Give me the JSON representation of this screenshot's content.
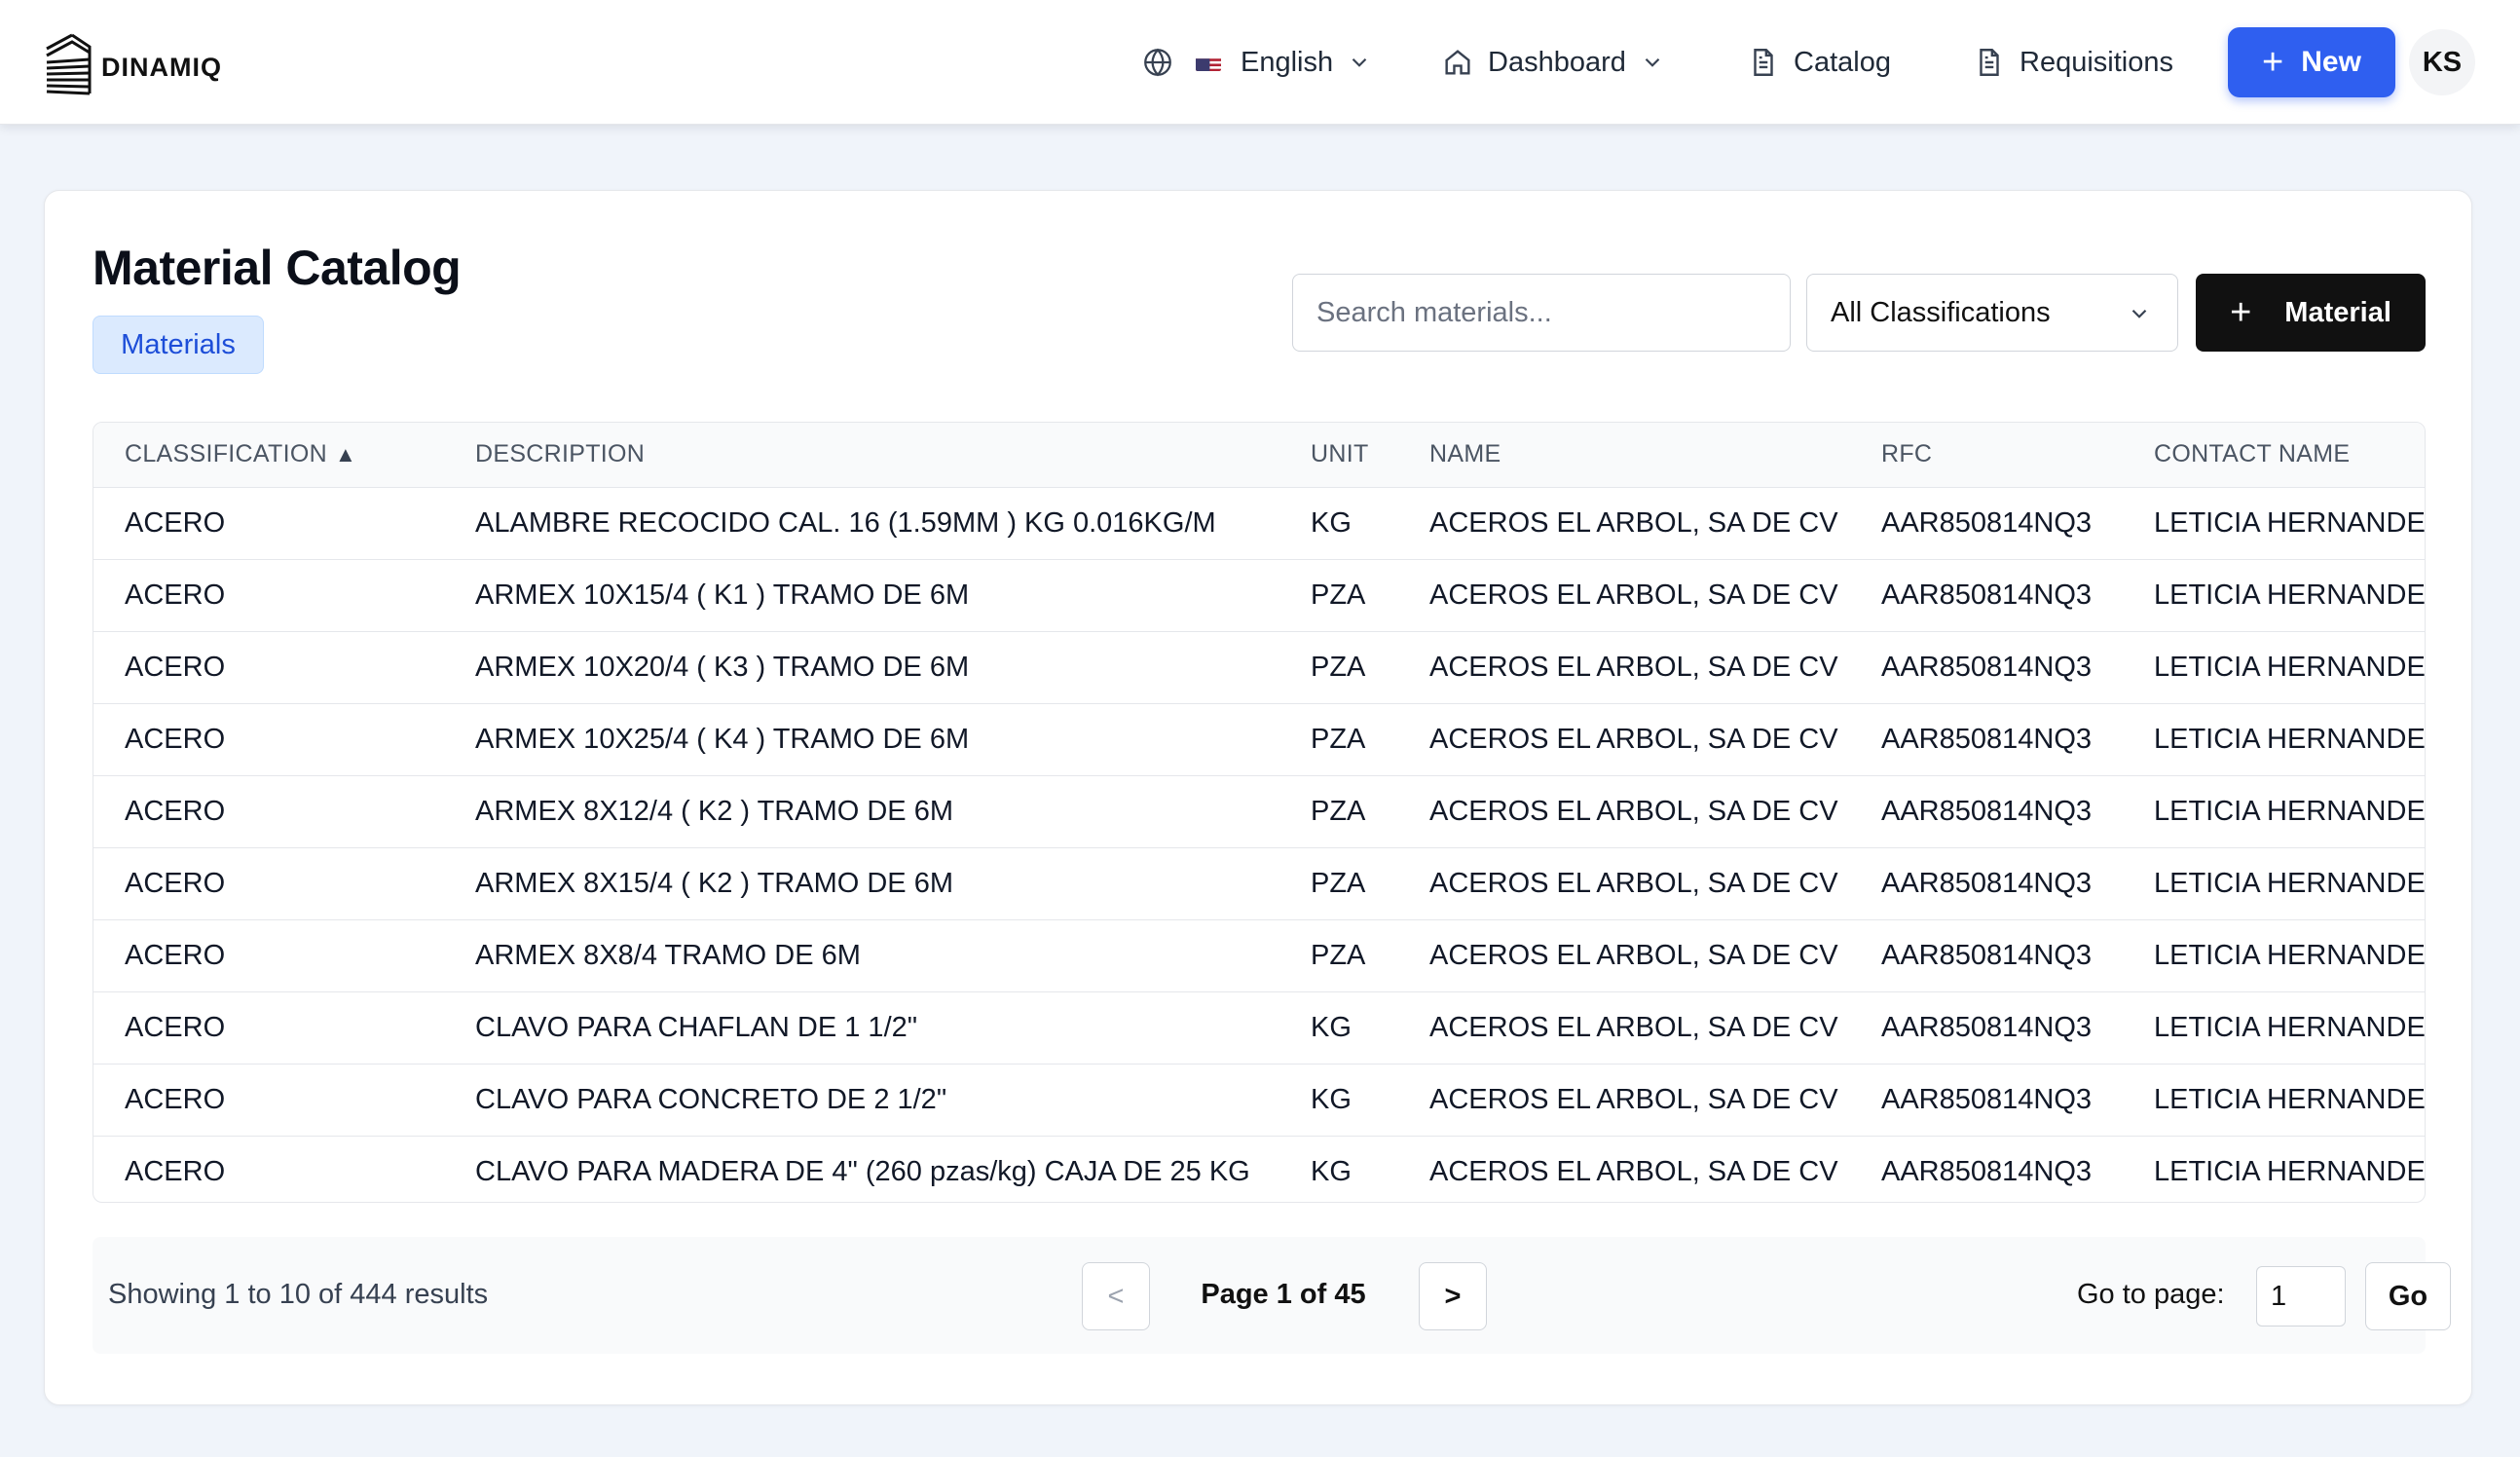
{
  "brand": {
    "name": "DINAMIQ"
  },
  "nav": {
    "language": "English",
    "dashboard": "Dashboard",
    "catalog": "Catalog",
    "requisitions": "Requisitions",
    "new_label": "New",
    "user_initials": "KS"
  },
  "page": {
    "title": "Material Catalog",
    "chip": "Materials",
    "search_placeholder": "Search materials...",
    "filter_value": "All Classifications",
    "add_button_label": "Material"
  },
  "table": {
    "columns": [
      "CLASSIFICATION",
      "DESCRIPTION",
      "UNIT",
      "NAME",
      "RFC",
      "CONTACT NAME"
    ],
    "sort_indicator": "▲",
    "rows": [
      [
        "ACERO",
        "ALAMBRE RECOCIDO CAL. 16 (1.59MM ) KG 0.016KG/M",
        "KG",
        "ACEROS EL ARBOL, SA DE CV",
        "AAR850814NQ3",
        "LETICIA HERNANDEZ"
      ],
      [
        "ACERO",
        "ARMEX 10X15/4 ( K1 ) TRAMO DE 6M",
        "PZA",
        "ACEROS EL ARBOL, SA DE CV",
        "AAR850814NQ3",
        "LETICIA HERNANDEZ"
      ],
      [
        "ACERO",
        "ARMEX 10X20/4 ( K3 ) TRAMO DE 6M",
        "PZA",
        "ACEROS EL ARBOL, SA DE CV",
        "AAR850814NQ3",
        "LETICIA HERNANDEZ"
      ],
      [
        "ACERO",
        "ARMEX 10X25/4 ( K4 ) TRAMO DE 6M",
        "PZA",
        "ACEROS EL ARBOL, SA DE CV",
        "AAR850814NQ3",
        "LETICIA HERNANDEZ"
      ],
      [
        "ACERO",
        "ARMEX 8X12/4 ( K2 ) TRAMO DE 6M",
        "PZA",
        "ACEROS EL ARBOL, SA DE CV",
        "AAR850814NQ3",
        "LETICIA HERNANDEZ"
      ],
      [
        "ACERO",
        "ARMEX 8X15/4 ( K2 ) TRAMO DE 6M",
        "PZA",
        "ACEROS EL ARBOL, SA DE CV",
        "AAR850814NQ3",
        "LETICIA HERNANDEZ"
      ],
      [
        "ACERO",
        "ARMEX 8X8/4 TRAMO DE 6M",
        "PZA",
        "ACEROS EL ARBOL, SA DE CV",
        "AAR850814NQ3",
        "LETICIA HERNANDEZ"
      ],
      [
        "ACERO",
        "CLAVO PARA CHAFLAN DE 1 1/2\"",
        "KG",
        "ACEROS EL ARBOL, SA DE CV",
        "AAR850814NQ3",
        "LETICIA HERNANDEZ"
      ],
      [
        "ACERO",
        "CLAVO PARA CONCRETO DE 2 1/2\"",
        "KG",
        "ACEROS EL ARBOL, SA DE CV",
        "AAR850814NQ3",
        "LETICIA HERNANDEZ"
      ],
      [
        "ACERO",
        "CLAVO PARA MADERA DE 4\" (260 pzas/kg) CAJA DE 25 KG",
        "KG",
        "ACEROS EL ARBOL, SA DE CV",
        "AAR850814NQ3",
        "LETICIA HERNANDEZ"
      ]
    ]
  },
  "pagination": {
    "showing": "Showing 1 to 10 of 444 results",
    "prev": "<",
    "next": ">",
    "page_info": "Page 1 of 45",
    "goto_label": "Go to page:",
    "goto_value": "1",
    "go_button": "Go"
  },
  "colors": {
    "accent": "#2f5ff0",
    "dark_button": "#111111",
    "chip_bg": "#dbeafe",
    "chip_text": "#1d4ed8",
    "page_bg": "#f0f4fa"
  },
  "icons": {
    "language": "globe-icon",
    "flag": "us-flag-icon",
    "dashboard": "home-icon",
    "catalog": "document-icon",
    "requisitions": "document-icon",
    "dropdown": "chevron-down-icon",
    "add": "plus-icon"
  }
}
